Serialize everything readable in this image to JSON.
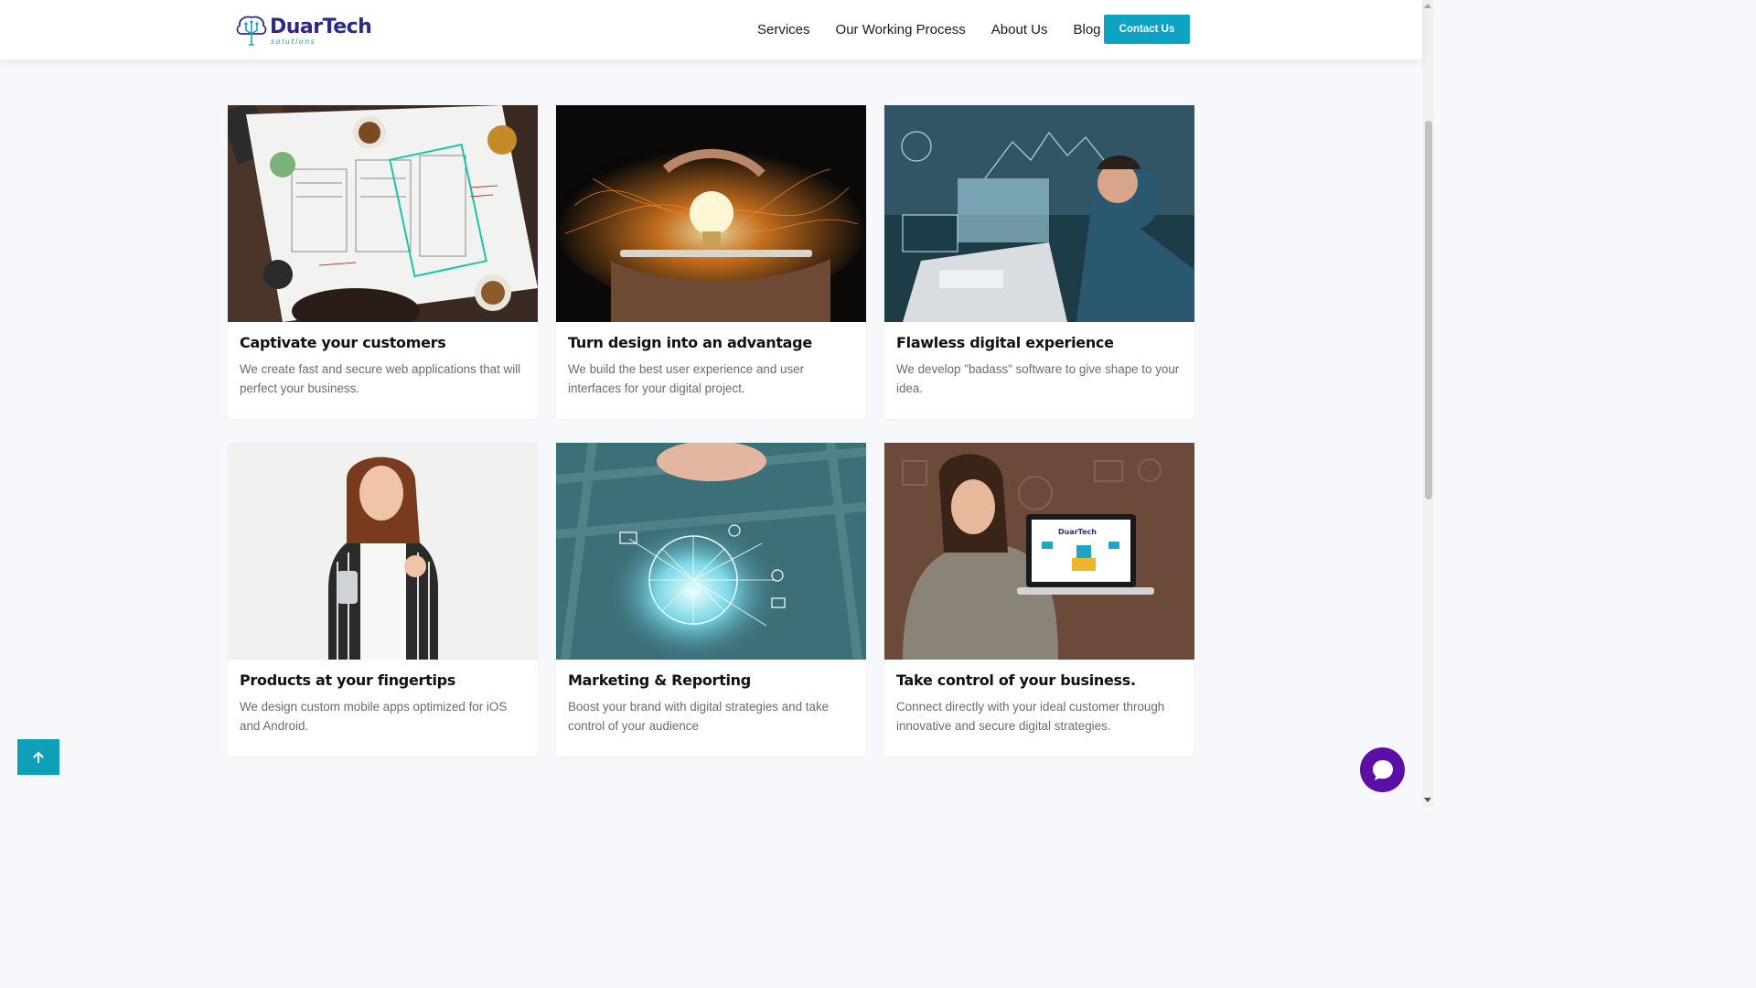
{
  "brand": {
    "name": "DuarTech",
    "tagline": "solutions",
    "primary_color": "#2d2a84",
    "accent_color": "#0da3c2"
  },
  "nav": {
    "items": [
      {
        "label": "Services"
      },
      {
        "label": "Our Working Process"
      },
      {
        "label": "About Us"
      },
      {
        "label": "Blog"
      }
    ],
    "contact_label": "Contact Us"
  },
  "cards": [
    {
      "title": "Captivate your customers",
      "description": "We create fast and secure web applications that will perfect your business.",
      "image": "wireframe-sketches-photo"
    },
    {
      "title": "Turn design into an advantage",
      "description": "We build the best user experience and user interfaces for your digital project.",
      "image": "lightbulb-tablet-photo"
    },
    {
      "title": "Flawless digital experience",
      "description": "We develop \"badass\" software to give shape to your idea.",
      "image": "analyst-screens-photo"
    },
    {
      "title": "Products at your fingertips",
      "description": "We design custom mobile apps optimized for iOS and Android.",
      "image": "woman-phone-photo"
    },
    {
      "title": "Marketing & Reporting",
      "description": "Boost your brand with digital strategies and take control of your audience",
      "image": "digital-network-photo"
    },
    {
      "title": "Take control of your business.",
      "description": "Connect directly with your ideal customer through innovative and secure digital strategies.",
      "image": "woman-laptop-photo"
    }
  ],
  "laptop_screen_brand": "DuarTech",
  "icons": {
    "back_to_top": "arrow-up-icon",
    "chat": "chat-bubble-icon"
  },
  "colors": {
    "back_to_top_bg": "#0f9fb8",
    "chat_bg": "#5b0fa6",
    "page_bg": "#f7f8fc"
  }
}
